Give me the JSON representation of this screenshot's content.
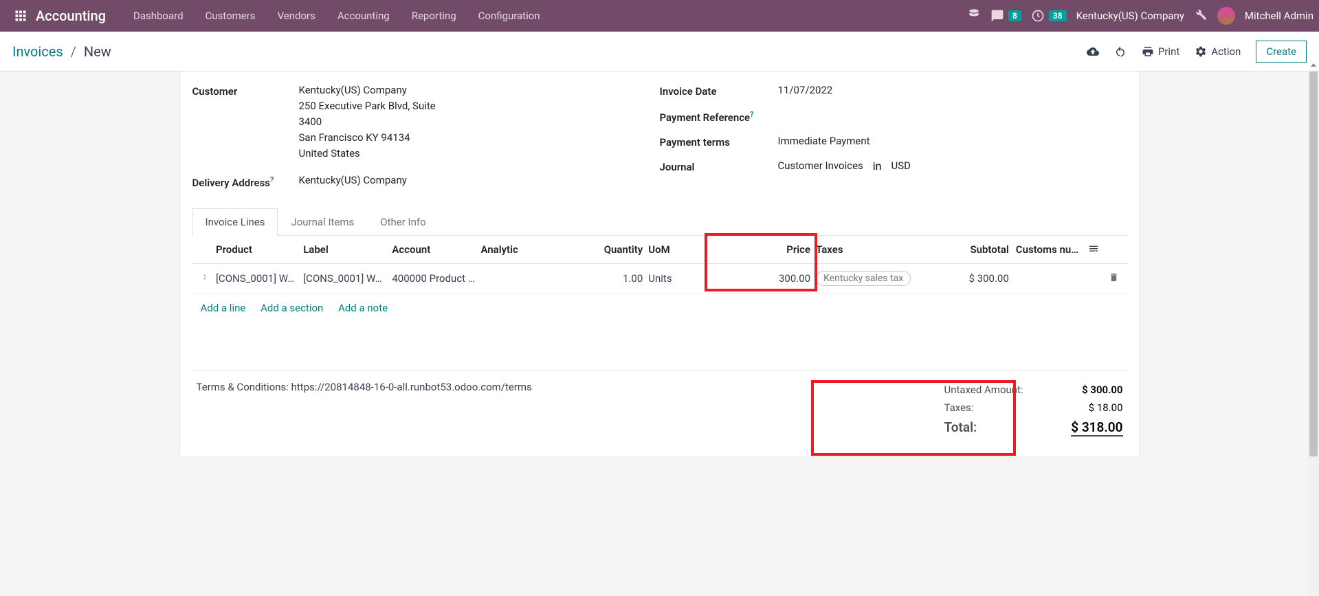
{
  "app_title": "Accounting",
  "nav_links": [
    "Dashboard",
    "Customers",
    "Vendors",
    "Accounting",
    "Reporting",
    "Configuration"
  ],
  "messages_badge": "8",
  "timer_badge": "38",
  "company": "Kentucky(US) Company",
  "user": "Mitchell Admin",
  "breadcrumb": {
    "root": "Invoices",
    "current": "New"
  },
  "controls": {
    "print": "Print",
    "action": "Action",
    "create": "Create"
  },
  "form": {
    "left": {
      "customer_label": "Customer",
      "customer_name": "Kentucky(US) Company",
      "address": [
        "250 Executive Park Blvd, Suite",
        "3400",
        "San Francisco KY 94134",
        "United States"
      ],
      "delivery_label": "Delivery Address",
      "delivery_val": "Kentucky(US) Company"
    },
    "right": {
      "invoice_date_label": "Invoice Date",
      "invoice_date": "11/07/2022",
      "pay_ref_label": "Payment Reference",
      "pay_ref": "",
      "pay_terms_label": "Payment terms",
      "pay_terms": "Immediate Payment",
      "journal_label": "Journal",
      "journal": "Customer Invoices",
      "in_lbl": "in",
      "currency": "USD"
    }
  },
  "tabs": [
    "Invoice Lines",
    "Journal Items",
    "Other Info"
  ],
  "table": {
    "headers": {
      "product": "Product",
      "label": "Label",
      "account": "Account",
      "analytic": "Analytic",
      "quantity": "Quantity",
      "uom": "UoM",
      "price": "Price",
      "taxes": "Taxes",
      "subtotal": "Subtotal",
      "customs": "Customs nu…"
    },
    "row": {
      "product": "[CONS_0001] W…",
      "label": "[CONS_0001] W…",
      "account": "400000 Product …",
      "analytic": "",
      "quantity": "1.00",
      "uom": "Units",
      "price": "300.00",
      "tax_tag": "Kentucky sales tax",
      "subtotal": "$ 300.00",
      "customs": ""
    },
    "add_line": "Add a line",
    "add_section": "Add a section",
    "add_note": "Add a note"
  },
  "footer": {
    "terms": "Terms & Conditions: https://20814848-16-0-all.runbot53.odoo.com/terms",
    "untaxed_label": "Untaxed Amount:",
    "untaxed_val": "$ 300.00",
    "taxes_label": "Taxes:",
    "taxes_val": "$ 18.00",
    "total_label": "Total:",
    "total_val": "$ 318.00"
  }
}
